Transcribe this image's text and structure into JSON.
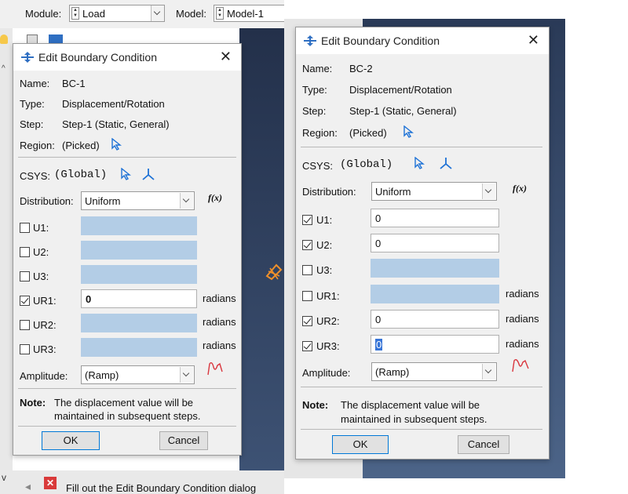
{
  "app": {
    "module_label": "Module:",
    "module_value": "Load",
    "model_label": "Model:",
    "model_value": "Model-1",
    "status_text": "Fill out the Edit Boundary Condition dialog"
  },
  "colors": {
    "disabled_field": "#b3cde6",
    "viewport_top": "#23304a",
    "viewport_bottom": "#3e5375",
    "pointer_icon": "#1e72d6"
  },
  "dialogs": [
    {
      "title": "Edit Boundary Condition",
      "name_label": "Name:",
      "name": "BC-1",
      "type_label": "Type:",
      "type": "Displacement/Rotation",
      "step_label": "Step:",
      "step": "Step-1 (Static, General)",
      "region_label": "Region:",
      "region": "(Picked)",
      "csys_label": "CSYS:",
      "csys": "(Global)",
      "distribution_label": "Distribution:",
      "distribution": "Uniform",
      "fx": "f(x)",
      "dofs": [
        {
          "label": "U1:",
          "checked": false,
          "value": "",
          "unit": ""
        },
        {
          "label": "U2:",
          "checked": false,
          "value": "",
          "unit": ""
        },
        {
          "label": "U3:",
          "checked": false,
          "value": "",
          "unit": ""
        },
        {
          "label": "UR1:",
          "checked": true,
          "value": "0",
          "unit": "radians"
        },
        {
          "label": "UR2:",
          "checked": false,
          "value": "",
          "unit": "radians"
        },
        {
          "label": "UR3:",
          "checked": false,
          "value": "",
          "unit": "radians"
        }
      ],
      "amplitude_label": "Amplitude:",
      "amplitude": "(Ramp)",
      "note_label": "Note:",
      "note_line1": "The displacement value will be",
      "note_line2": "maintained in subsequent steps.",
      "ok": "OK",
      "cancel": "Cancel"
    },
    {
      "title": "Edit Boundary Condition",
      "name_label": "Name:",
      "name": "BC-2",
      "type_label": "Type:",
      "type": "Displacement/Rotation",
      "step_label": "Step:",
      "step": "Step-1 (Static, General)",
      "region_label": "Region:",
      "region": "(Picked)",
      "csys_label": "CSYS:",
      "csys": "(Global)",
      "distribution_label": "Distribution:",
      "distribution": "Uniform",
      "fx": "f(x)",
      "dofs": [
        {
          "label": "U1:",
          "checked": true,
          "value": "0",
          "unit": ""
        },
        {
          "label": "U2:",
          "checked": true,
          "value": "0",
          "unit": ""
        },
        {
          "label": "U3:",
          "checked": false,
          "value": "",
          "unit": ""
        },
        {
          "label": "UR1:",
          "checked": false,
          "value": "",
          "unit": "radians"
        },
        {
          "label": "UR2:",
          "checked": true,
          "value": "0",
          "unit": "radians"
        },
        {
          "label": "UR3:",
          "checked": true,
          "value": "0",
          "unit": "radians"
        }
      ],
      "amplitude_label": "Amplitude:",
      "amplitude": "(Ramp)",
      "note_label": "Note:",
      "note_line1": "The displacement value will be",
      "note_line2": "maintained in subsequent steps.",
      "ok": "OK",
      "cancel": "Cancel"
    }
  ]
}
